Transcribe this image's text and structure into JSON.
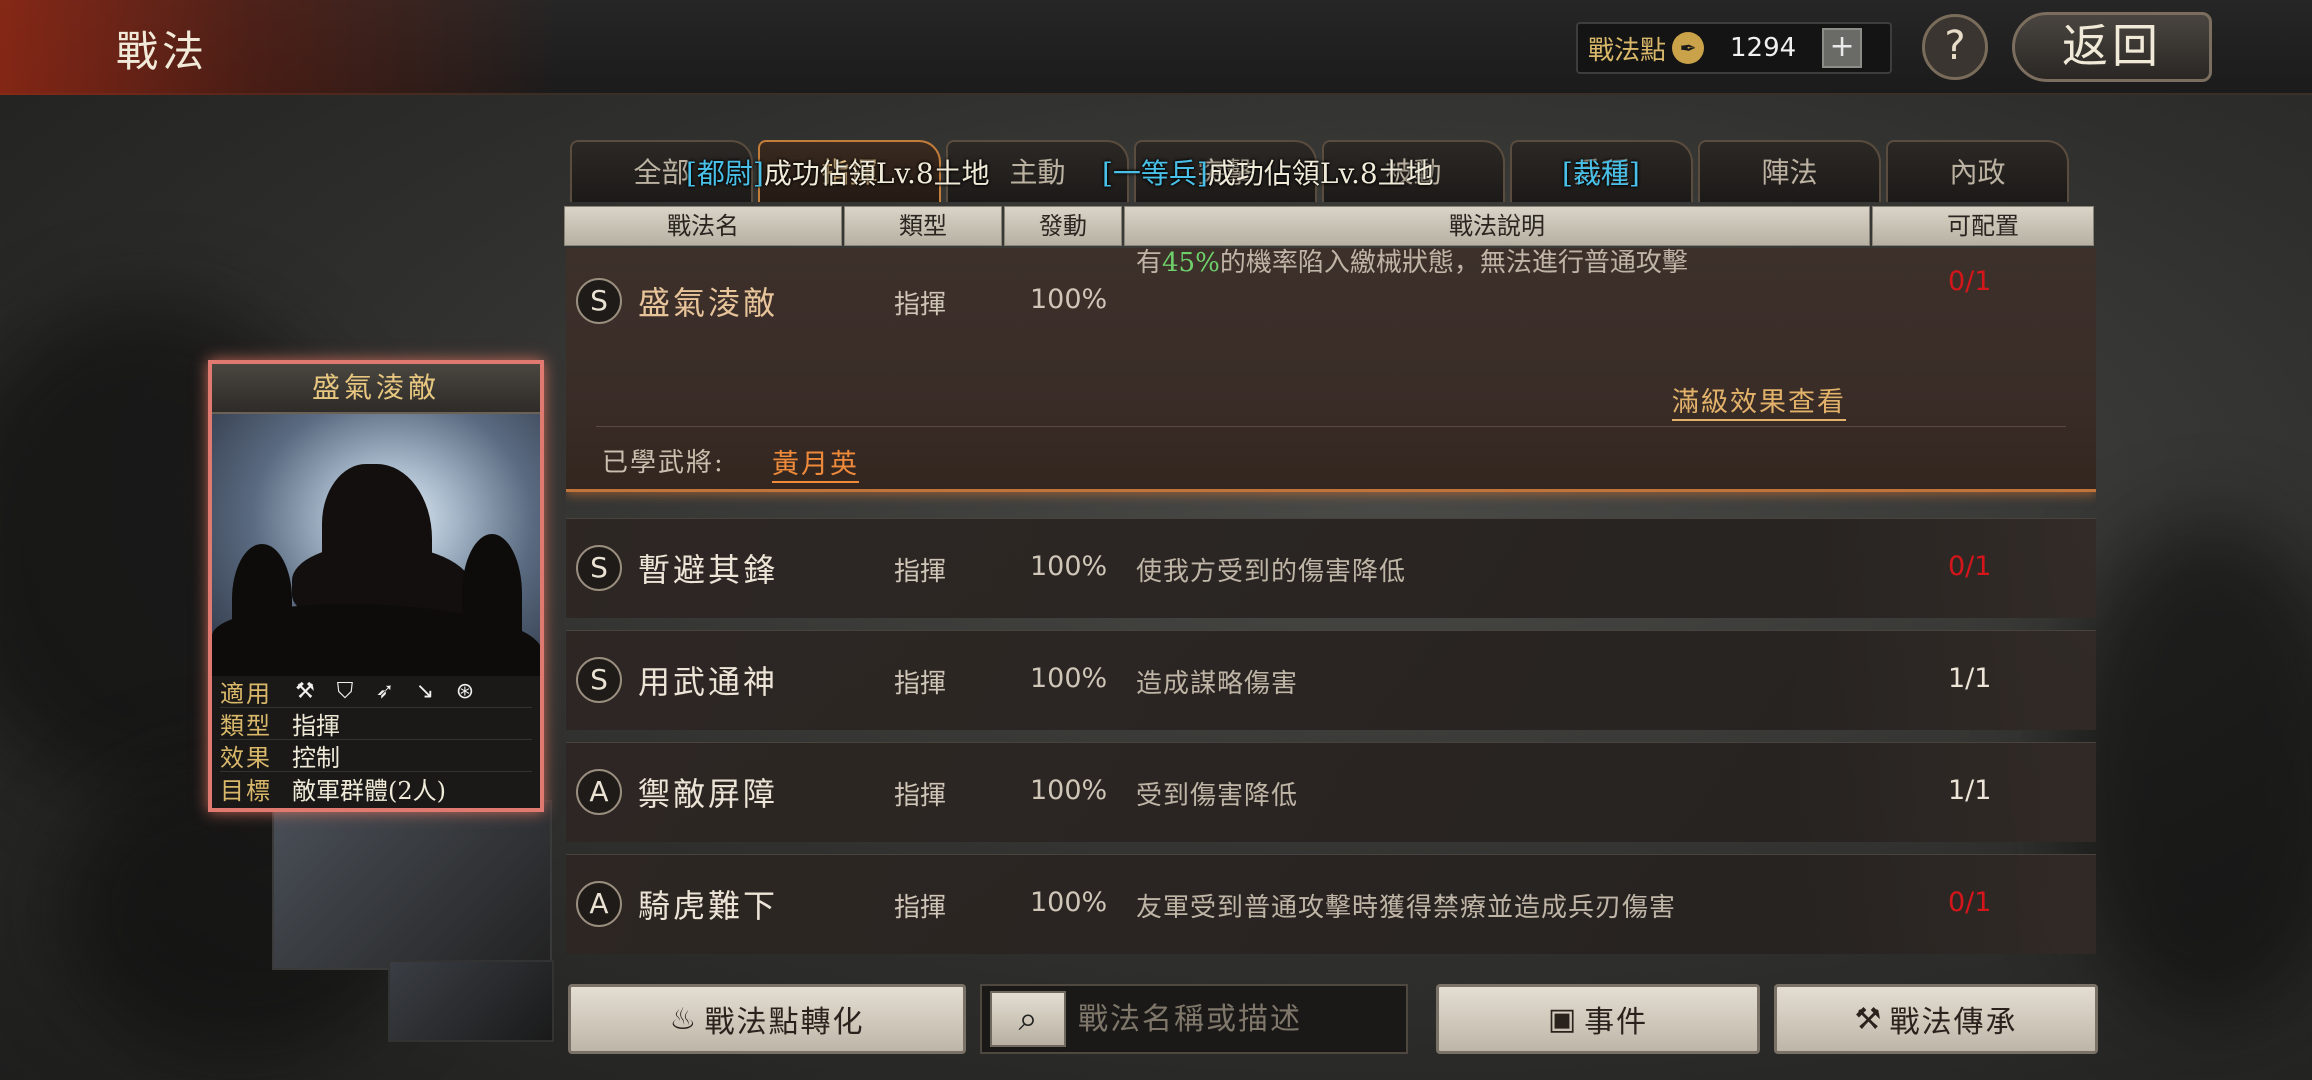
{
  "header": {
    "title": "戰法",
    "points_label": "戰法點",
    "points_icon": "quill-icon",
    "points_value": "1294",
    "plus_label": "+",
    "help_label": "?",
    "back_label": "返回"
  },
  "tabs": [
    {
      "label": "全部"
    },
    {
      "label": "指揮"
    },
    {
      "label": "主動"
    },
    {
      "label": "突擊"
    },
    {
      "label": "被動"
    },
    {
      "label": "兵種"
    },
    {
      "label": "陣法"
    },
    {
      "label": "內政"
    }
  ],
  "tab_overlay": {
    "tag1": "[都尉]",
    "text1": "成功佔領Lv.8土地",
    "tag2": "[一等兵]",
    "text2": "成功佔領Lv.8土地",
    "tag3": "[裁種]"
  },
  "columns": {
    "name": "戰法名",
    "type": "類型",
    "rate": "發動",
    "desc": "戰法說明",
    "config": "可配置"
  },
  "expanded": {
    "grade": "S",
    "name": "盛氣淩敵",
    "type": "指揮",
    "rate": "100%",
    "desc_pre": "有",
    "desc_highlight": "45%",
    "desc_post": "的機率陷入繳械狀態，無法進行普通攻擊",
    "config": "0/1",
    "full_link": "滿級效果查看",
    "learned_label": "已學武將:",
    "learned_general": "黃月英"
  },
  "rows": [
    {
      "grade": "S",
      "name": "暫避其鋒",
      "type": "指揮",
      "rate": "100%",
      "desc": "使我方受到的傷害降低",
      "config": "0/1"
    },
    {
      "grade": "S",
      "name": "用武通神",
      "type": "指揮",
      "rate": "100%",
      "desc": "造成謀略傷害",
      "config": "1/1"
    },
    {
      "grade": "A",
      "name": "禦敵屏障",
      "type": "指揮",
      "rate": "100%",
      "desc": "受到傷害降低",
      "config": "1/1"
    },
    {
      "grade": "A",
      "name": "騎虎難下",
      "type": "指揮",
      "rate": "100%",
      "desc": "友軍受到普通攻擊時獲得禁療並造成兵刃傷害",
      "config": "0/1"
    }
  ],
  "card": {
    "title": "盛氣淩敵",
    "applicable_label": "適用",
    "unit_icons": [
      "axe-icon",
      "shield-icon",
      "bow-icon",
      "spear-icon",
      "wheel-icon"
    ],
    "type_label": "類型",
    "type_value": "指揮",
    "effect_label": "效果",
    "effect_value": "控制",
    "target_label": "目標",
    "target_value": "敵軍群體(2人)"
  },
  "bottom": {
    "convert_label": "戰法點轉化",
    "search_placeholder": "戰法名稱或描述",
    "event_label": "事件",
    "inherit_label": "戰法傳承"
  },
  "colors": {
    "accent": "#c0733a",
    "config_red": "#d4161a",
    "highlight_green": "#6fd06a",
    "tag_cyan": "#49c0e8",
    "card_border": "#e07a70"
  }
}
